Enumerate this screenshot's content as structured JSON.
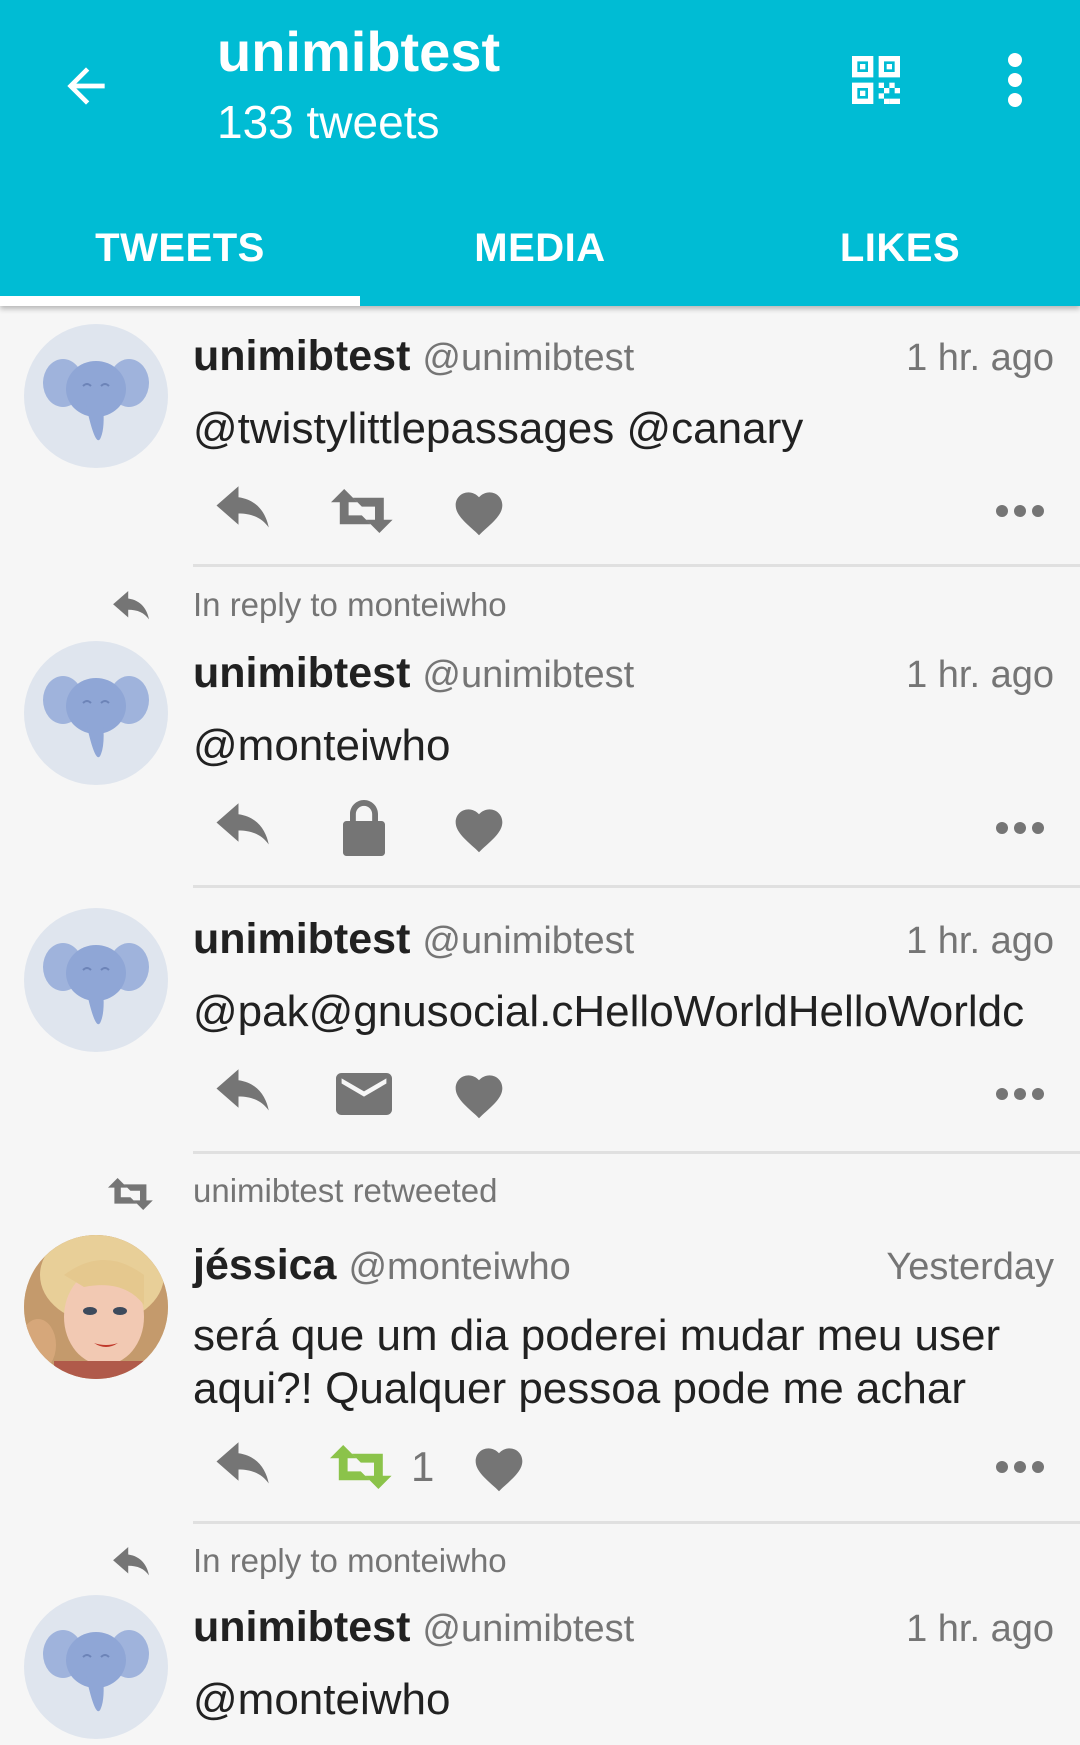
{
  "header": {
    "title": "unimibtest",
    "subtitle": "133 tweets",
    "back_icon": "arrow-left-icon",
    "qr_icon": "qr-code-icon",
    "more_icon": "more-vert-icon"
  },
  "tabs": [
    {
      "label": "TWEETS",
      "active": true
    },
    {
      "label": "MEDIA",
      "active": false
    },
    {
      "label": "LIKES",
      "active": false
    }
  ],
  "colors": {
    "accent": "#00bcd4",
    "retweet_active": "#8bc34a",
    "icon_gray": "#757575"
  },
  "tweets": [
    {
      "name": "unimibtest",
      "handle": "@unimibtest",
      "time": "1 hr. ago",
      "text": "@twistylittlepassages @canary",
      "middle_icon": "retweet-icon"
    },
    {
      "context": "In reply to monteiwho",
      "name": "unimibtest",
      "handle": "@unimibtest",
      "time": "1 hr. ago",
      "text": "@monteiwho",
      "middle_icon": "lock-icon"
    },
    {
      "name": "unimibtest",
      "handle": "@unimibtest",
      "time": "1 hr. ago",
      "text": "@pak@gnusocial.cHelloWorldHelloWorldc",
      "middle_icon": "mail-icon"
    },
    {
      "context": "unimibtest retweeted",
      "name": "jéssica",
      "handle": "@monteiwho",
      "time": "Yesterday",
      "text": "será que um dia poderei mudar meu user aqui?! Qualquer pessoa pode me achar",
      "middle_icon": "retweet-icon",
      "retweet_count": "1"
    },
    {
      "context": "In reply to monteiwho",
      "name": "unimibtest",
      "handle": "@unimibtest",
      "time": "1 hr. ago",
      "text": "@monteiwho"
    }
  ]
}
